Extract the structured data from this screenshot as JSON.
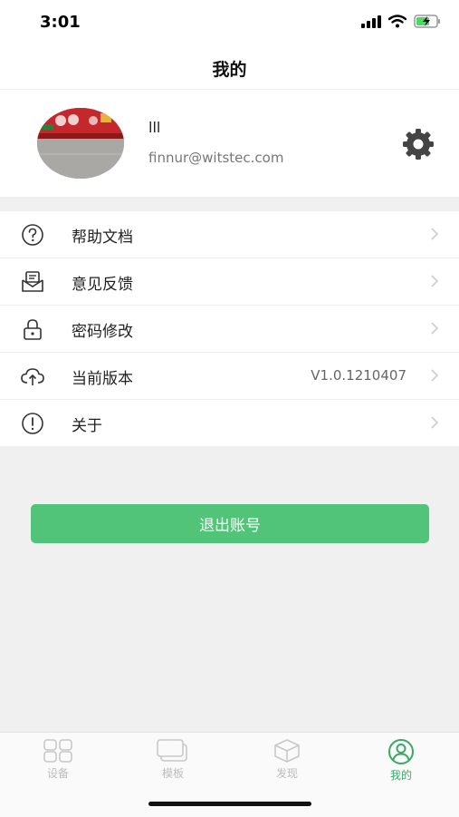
{
  "status_bar": {
    "time": "3:01"
  },
  "nav": {
    "title": "我的"
  },
  "profile": {
    "name": "lll",
    "email": "finnur@witstec.com"
  },
  "menu": [
    {
      "label": "帮助文档",
      "icon": "help-circle-icon"
    },
    {
      "label": "意见反馈",
      "icon": "feedback-envelope-icon"
    },
    {
      "label": "密码修改",
      "icon": "lock-icon"
    },
    {
      "label": "当前版本",
      "value": "V1.0.1210407",
      "icon": "cloud-upload-icon"
    },
    {
      "label": "关于",
      "icon": "info-circle-icon"
    }
  ],
  "logout": {
    "label": "退出账号"
  },
  "tabs": [
    {
      "label": "设备",
      "icon": "grid-icon"
    },
    {
      "label": "模板",
      "icon": "cards-icon"
    },
    {
      "label": "发现",
      "icon": "cube-icon"
    },
    {
      "label": "我的",
      "icon": "user-circle-icon",
      "active": true
    }
  ],
  "colors": {
    "accent": "#52c47a",
    "active_tab": "#3aa867",
    "inactive_tab": "#bdbdbd"
  }
}
